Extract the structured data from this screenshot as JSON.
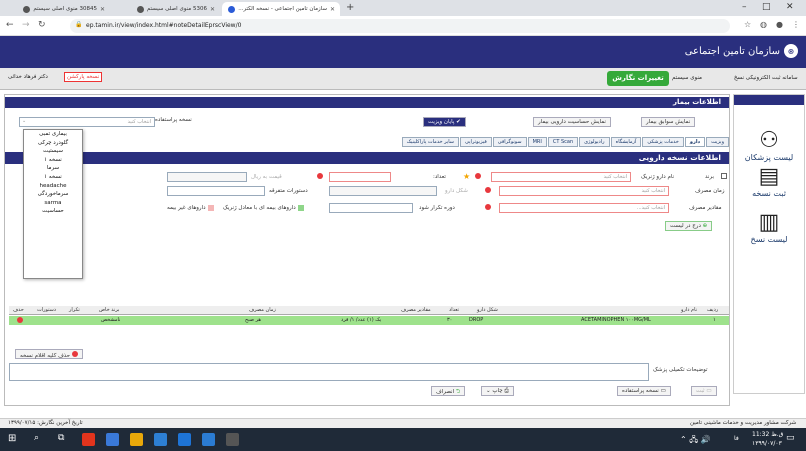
{
  "browser": {
    "tabs": [
      {
        "title": "30845 منوی اصلی سیستم"
      },
      {
        "title": "5306 منوی اصلی سیستم"
      },
      {
        "title": "سازمان تامین اجتماعی - نسخه الکتر..."
      }
    ],
    "new_tab": "+",
    "address": "ep.tamin.ir/view/index.html#noteDetailEprscView/0",
    "window_controls": [
      "–",
      "□",
      "✕"
    ]
  },
  "header": {
    "logo_text": "سازمان تامین اجتماعی"
  },
  "toolbar": {
    "system_name": "سامانه ثبت الکترونیکی نسخ",
    "system_menu": "منوی سیستم",
    "changes_button": "تغییرات نگارش",
    "doctor": "دکتر فرهاد خدائی",
    "unsaved_badge": "نسخه پارکشن"
  },
  "sidenav": {
    "items": [
      {
        "label": "لیست پزشکان",
        "icon": "doctors-icon"
      },
      {
        "label": "ثبت نسخه",
        "icon": "prescription-icon"
      },
      {
        "label": "لیست نسخ",
        "icon": "list-icon"
      }
    ]
  },
  "patient": {
    "section_title": "اطلاعات بیمار",
    "history_btn": "نمایش سوابق بیمار",
    "coverage_btn": "نمایش حساسیت دارویی بیمار",
    "end_visit_btn": "پایان ویزیت",
    "template_label": "نسخه پراستفاده",
    "template_placeholder": "انتخاب کنید"
  },
  "service_tabs": [
    "ویزیت",
    "دارو",
    "خدمات پزشکی",
    "آزمایشگاه",
    "رادیولوژی",
    "CT Scan",
    "MRI",
    "سونوگرافی",
    "فیزیوتراپی",
    "سایر خدمات پاراکلینیک"
  ],
  "drug": {
    "section_title": "اطلاعات نسخه دارویی",
    "brand_label": "برند",
    "generic_label": "نام دارو ژنریک",
    "generic_placeholder": "انتخاب کنید",
    "count_label": "تعداد:",
    "price_label": "قیمت به ریال",
    "usage_time_label": "زمان مصرف",
    "usage_time_placeholder": "انتخاب کنید",
    "form_label": "شکل دارو",
    "instructions_label": "دستورات متفرقه",
    "dose_label": "مقادیر مصرف",
    "dose_placeholder": "انتخاب کنید...",
    "repeat_label": "دوره تکرار شود",
    "insured_label": "داروهای بیمه ای با معادل ژنریک",
    "non_insured_label": "داروهای غیر بیمه",
    "add_button": "درج در لیست"
  },
  "template_options": [
    "بیماری تمبی",
    "گلودرد چرکی",
    "سیستیت",
    "نسخه ۱",
    "سرما",
    "نسخه ۱",
    "headache",
    "سرماخوردگی",
    "sarma",
    "حساسیت"
  ],
  "grid": {
    "headers": [
      "ردیف",
      "نام دارو",
      "شکل دارو",
      "تعداد",
      "مقادیر مصرف",
      "زمان مصرف",
      "برند خاص",
      "تکرار",
      "دستورات",
      "حذف"
    ],
    "rows": [
      {
        "index": "۱",
        "name": "ACETAMINOPHEN ۱۰۰MG/ML",
        "form": "DROP",
        "count": "۳۰",
        "dose": "یک (۱) عدد/ ۱/ فرد",
        "time": "هر صبح",
        "brand": "نامشخص"
      }
    ]
  },
  "bottom": {
    "delete_all": "حذف کلیه اقلام نسخه",
    "doctor_notes": "توضیحات تکمیلی پزشک",
    "save_btn": "ثبت",
    "save_template_btn": "نسخه پراستفاده",
    "print_btn": "چاپ",
    "cancel_btn": "انصراف"
  },
  "footer": {
    "last_update": "تاریخ آخرین نگارش: ۱۳۹۹/۰۷/۱۵",
    "company": "شرکت مشاور مدیریت و خدمات ماشینی تامین"
  },
  "taskbar": {
    "time": "11:32 ق.ظ",
    "date": "۱۳۹۹/۰۷/۰۳",
    "lang": "فا"
  },
  "colors": {
    "brand": "#2a2f7e",
    "green": "#35a93a",
    "row_highlight": "#9ee28c",
    "danger": "#e8383d"
  }
}
